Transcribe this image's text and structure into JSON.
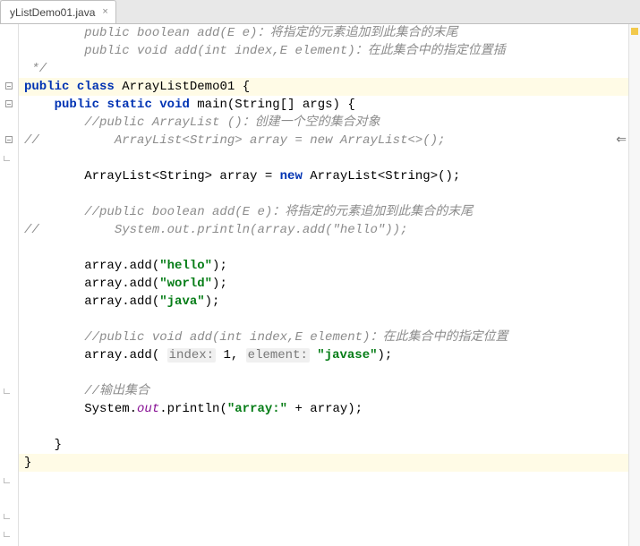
{
  "tab": {
    "filename": "yListDemo01.java",
    "close_glyph": "×"
  },
  "lines": {
    "l1": "        public boolean add(E e)：将指定的元素追加到此集合的末尾",
    "l2": "        public void add(int index,E element)：在此集合中的指定位置插",
    "l3": " */",
    "l4a": "public",
    "l4b": "class",
    "l4c": "ArrayListDemo01",
    "l4d": "{",
    "l5a": "public",
    "l5b": "static",
    "l5c": "void",
    "l5d": "main",
    "l5e": "(String[] args) {",
    "l6": "        //public ArrayList ()：创建一个空的集合对象",
    "l7": "          ArrayList<String> array = new ArrayList<>();",
    "l8": "",
    "l9a": "        ArrayList<String> array = ",
    "l9b": "new",
    "l9c": " ArrayList<String>();",
    "l10": "",
    "l11": "        //public boolean add(E e)：将指定的元素追加到此集合的末尾",
    "l12": "          System.out.println(array.add(\"hello\"));",
    "l13": "",
    "l14a": "        array.add(",
    "l14b": "\"hello\"",
    "l14c": ");",
    "l15a": "        array.add(",
    "l15b": "\"world\"",
    "l15c": ");",
    "l16a": "        array.add(",
    "l16b": "\"java\"",
    "l16c": ");",
    "l17": "",
    "l18": "        //public void add(int index,E element)：在此集合中的指定位置",
    "l19a": "        array.add( ",
    "l19h1": "index:",
    "l19b": " 1, ",
    "l19h2": "element:",
    "l19c": " ",
    "l19d": "\"javase\"",
    "l19e": ");",
    "l20": "",
    "l21": "        //输出集合",
    "l22a": "        System.",
    "l22out": "out",
    "l22b": ".println(",
    "l22c": "\"array:\"",
    "l22d": " + array);",
    "l23": "",
    "l24": "    }",
    "l25": "}",
    "slash": "//"
  },
  "glyphs": {
    "ret_arrow": "⇐"
  }
}
